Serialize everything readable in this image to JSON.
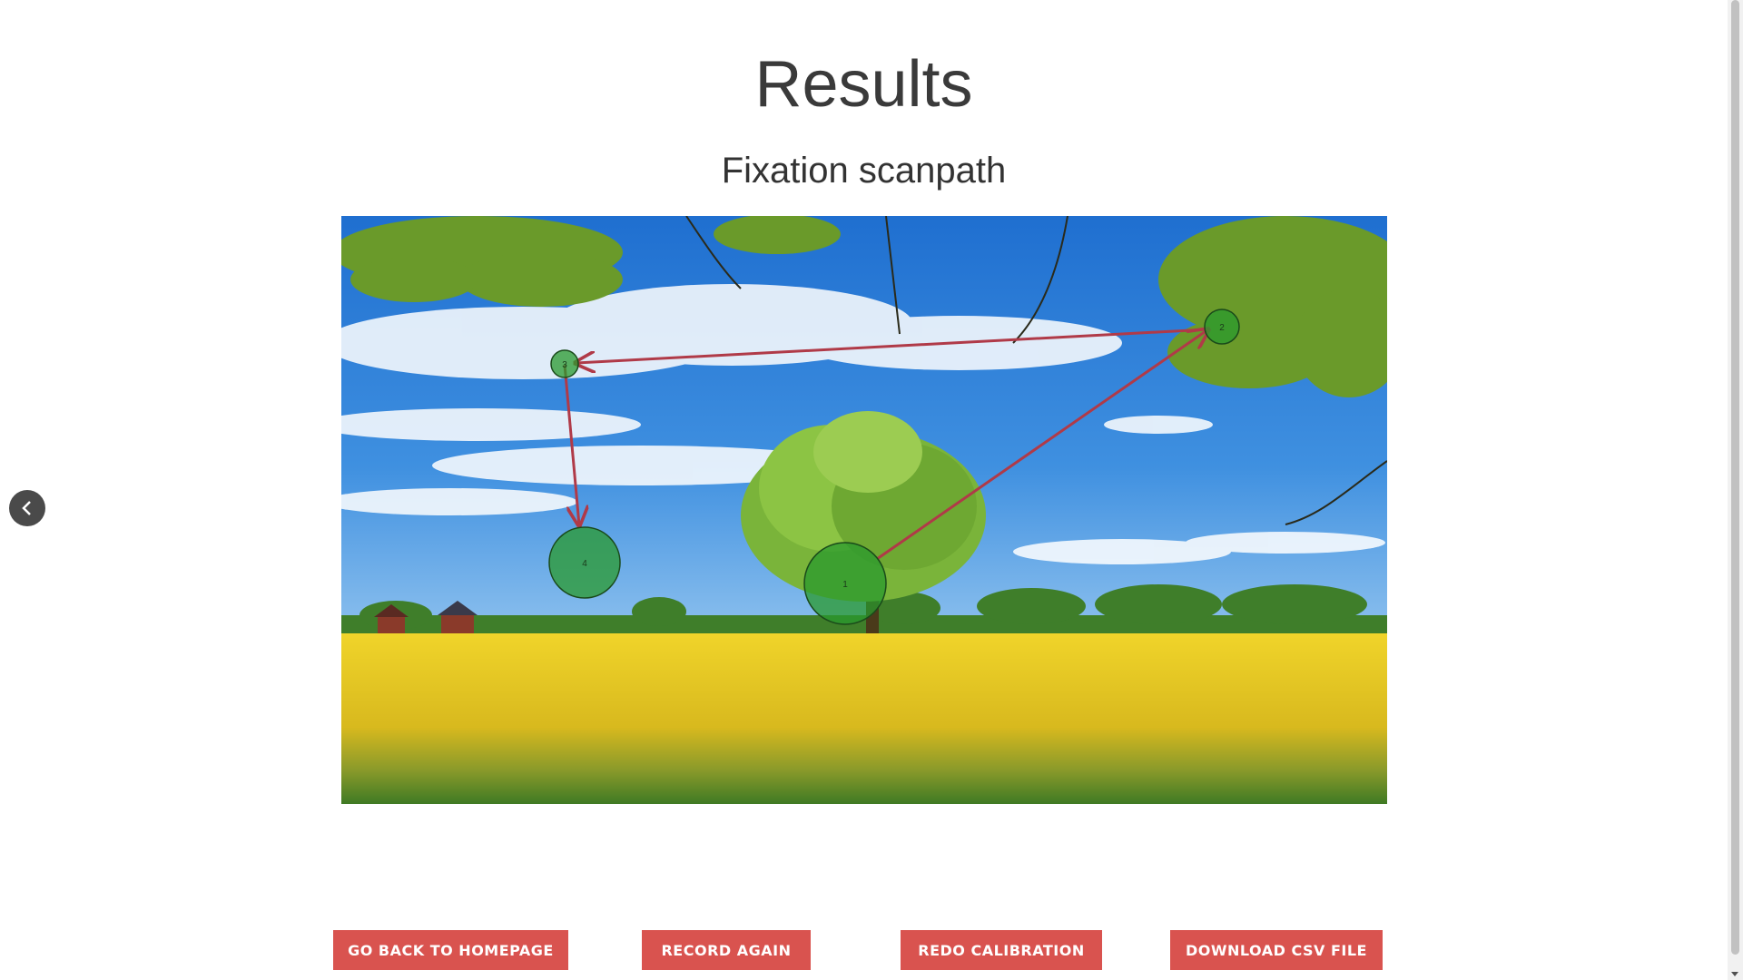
{
  "page": {
    "title": "Results",
    "subtitle": "Fixation scanpath"
  },
  "scanpath": {
    "fixations": [
      {
        "label": "1",
        "color": "#2a9a2e"
      },
      {
        "label": "2",
        "color": "#2a9a2e"
      },
      {
        "label": "3",
        "color": "#2a9a2e"
      },
      {
        "label": "4",
        "color": "#2a9a2e"
      }
    ],
    "saccade_color": "#b03a48"
  },
  "nav": {
    "prev_icon": "chevron-left-icon"
  },
  "buttons": {
    "home": "GO BACK TO HOMEPAGE",
    "record": "RECORD AGAIN",
    "redo": "REDO CALIBRATION",
    "csv": "DOWNLOAD CSV FILE"
  },
  "colors": {
    "button_bg": "#d9534f",
    "button_text": "#ffffff"
  }
}
